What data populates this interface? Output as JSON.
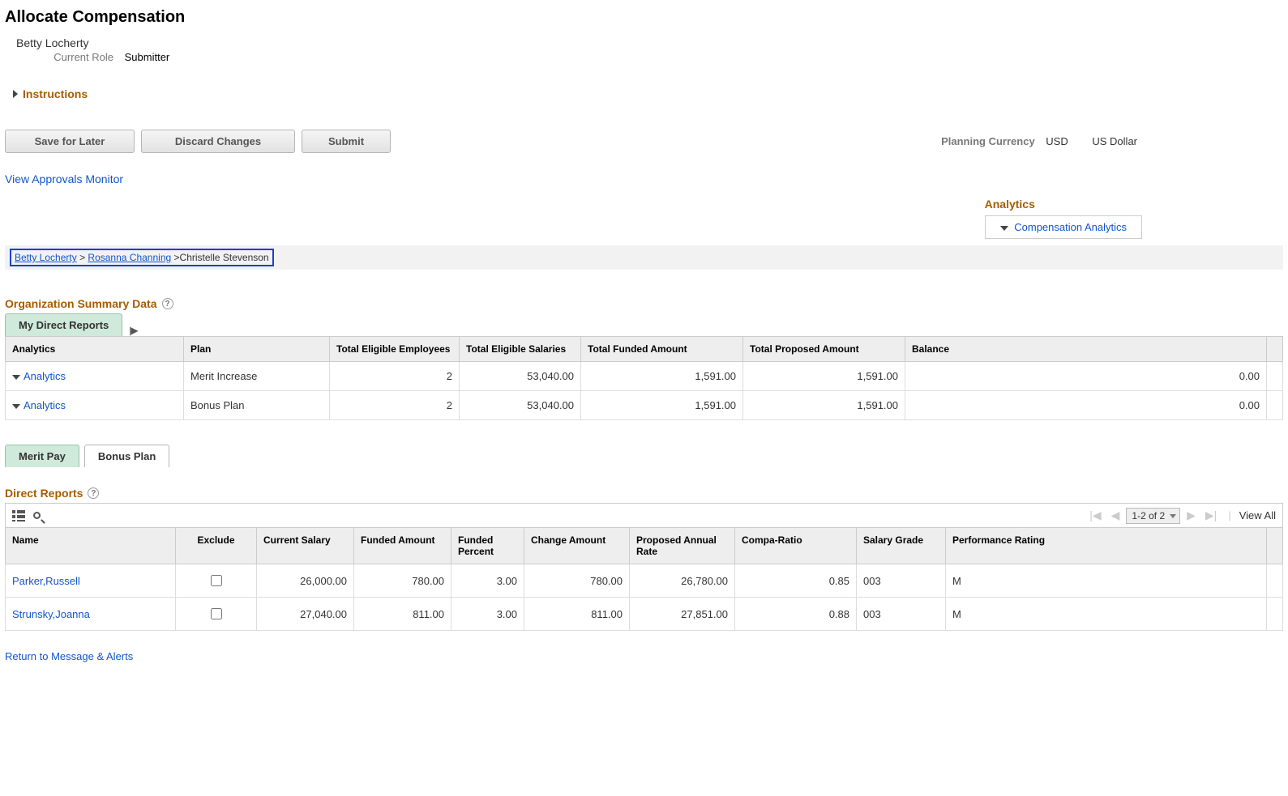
{
  "page": {
    "title": "Allocate Compensation",
    "user_name": "Betty Locherty",
    "role_label": "Current Role",
    "role_value": "Submitter",
    "instructions_label": "Instructions"
  },
  "actions": {
    "save": "Save for Later",
    "discard": "Discard Changes",
    "submit": "Submit",
    "approvals_link": "View Approvals Monitor",
    "return_link": "Return to Message & Alerts"
  },
  "currency": {
    "label": "Planning Currency",
    "code": "USD",
    "name": "US Dollar"
  },
  "analytics_panel": {
    "header": "Analytics",
    "link": "Compensation Analytics"
  },
  "breadcrumb": {
    "level1": "Betty Locherty",
    "level2": "Rosanna Channing",
    "level3": "Christelle Stevenson"
  },
  "org_summary": {
    "title": "Organization Summary Data",
    "tab_label": "My Direct Reports",
    "headers": {
      "analytics": "Analytics",
      "plan": "Plan",
      "employees": "Total Eligible Employees",
      "salaries": "Total Eligible Salaries",
      "funded": "Total Funded Amount",
      "proposed": "Total Proposed Amount",
      "balance": "Balance"
    },
    "rows": [
      {
        "analytics": "Analytics",
        "plan": "Merit Increase",
        "employees": "2",
        "salaries": "53,040.00",
        "funded": "1,591.00",
        "proposed": "1,591.00",
        "balance": "0.00"
      },
      {
        "analytics": "Analytics",
        "plan": "Bonus Plan",
        "employees": "2",
        "salaries": "53,040.00",
        "funded": "1,591.00",
        "proposed": "1,591.00",
        "balance": "0.00"
      }
    ]
  },
  "plan_tabs": {
    "merit": "Merit Pay",
    "bonus": "Bonus Plan"
  },
  "direct_reports": {
    "title": "Direct Reports",
    "pager": "1-2 of 2",
    "view_all": "View All",
    "headers": {
      "name": "Name",
      "exclude": "Exclude",
      "current_salary": "Current Salary",
      "funded_amount": "Funded Amount",
      "funded_percent": "Funded Percent",
      "change_amount": "Change Amount",
      "proposed_rate": "Proposed Annual Rate",
      "compa": "Compa-Ratio",
      "grade": "Salary Grade",
      "perf": "Performance Rating"
    },
    "rows": [
      {
        "name": "Parker,Russell",
        "current_salary": "26,000.00",
        "funded_amount": "780.00",
        "funded_percent": "3.00",
        "change_amount": "780.00",
        "proposed_rate": "26,780.00",
        "compa": "0.85",
        "grade": "003",
        "perf": "M"
      },
      {
        "name": "Strunsky,Joanna",
        "current_salary": "27,040.00",
        "funded_amount": "811.00",
        "funded_percent": "3.00",
        "change_amount": "811.00",
        "proposed_rate": "27,851.00",
        "compa": "0.88",
        "grade": "003",
        "perf": "M"
      }
    ]
  }
}
